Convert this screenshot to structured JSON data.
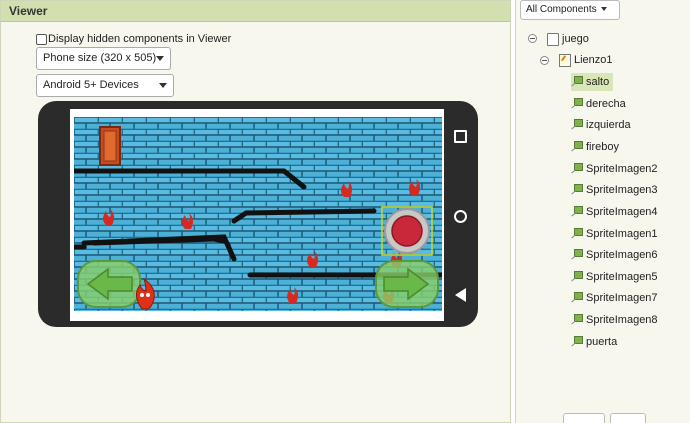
{
  "viewer": {
    "title": "Viewer",
    "hidden_components_label": "Display hidden components in Viewer",
    "size_select": "Phone size (320 x 505)",
    "theme_select": "Android 5+ Devices"
  },
  "components": {
    "dropdown_label": "All Components",
    "tree": [
      {
        "label": "juego",
        "icon": "screen-icon"
      },
      {
        "label": "Lienzo1",
        "icon": "canvas-icon"
      },
      {
        "label": "salto",
        "icon": "sprite-icon",
        "selected": true
      },
      {
        "label": "derecha",
        "icon": "sprite-icon"
      },
      {
        "label": "izquierda",
        "icon": "sprite-icon"
      },
      {
        "label": "fireboy",
        "icon": "sprite-icon"
      },
      {
        "label": "SpriteImagen2",
        "icon": "sprite-icon"
      },
      {
        "label": "SpriteImagen3",
        "icon": "sprite-icon"
      },
      {
        "label": "SpriteImagen4",
        "icon": "sprite-icon"
      },
      {
        "label": "SpriteImagen1",
        "icon": "sprite-icon"
      },
      {
        "label": "SpriteImagen6",
        "icon": "sprite-icon"
      },
      {
        "label": "SpriteImagen5",
        "icon": "sprite-icon"
      },
      {
        "label": "SpriteImagen7",
        "icon": "sprite-icon"
      },
      {
        "label": "SpriteImagen8",
        "icon": "sprite-icon"
      },
      {
        "label": "puerta",
        "icon": "sprite-icon"
      }
    ]
  },
  "colors": {
    "header_bg": "#d2e0b0",
    "pane_bg": "#f7f7ee",
    "brick_blue": "#3aa0c9",
    "selection_bg": "#d9e7b8"
  }
}
